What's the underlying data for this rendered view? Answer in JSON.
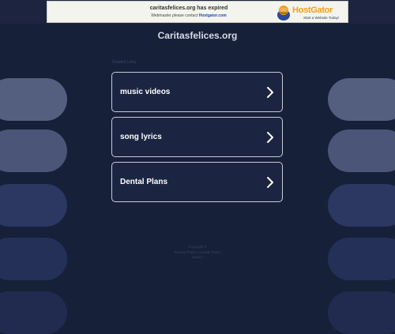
{
  "banner": {
    "line1": "caritasfelices.org has expired",
    "line2_prefix": "Webmaster please contact ",
    "line2_link": "Hostgator.com",
    "brand": "HostGator",
    "tagline": "Start a Website Today!"
  },
  "site_title": "Caritasfelices.org",
  "related_heading": "Related Links",
  "links": [
    {
      "label": "music videos"
    },
    {
      "label": "song lyrics"
    },
    {
      "label": "Dental Plans"
    }
  ],
  "footer": {
    "line1": "Copyright ©",
    "line2": "Privacy Policy  |  Cookie Policy",
    "line3": "Imprint"
  },
  "colors": {
    "background": "#162039",
    "pill_light": "#545f80",
    "pill_dark": "#2a3560",
    "card_border": "#c8ccd8",
    "brand_orange": "#f2a014"
  }
}
